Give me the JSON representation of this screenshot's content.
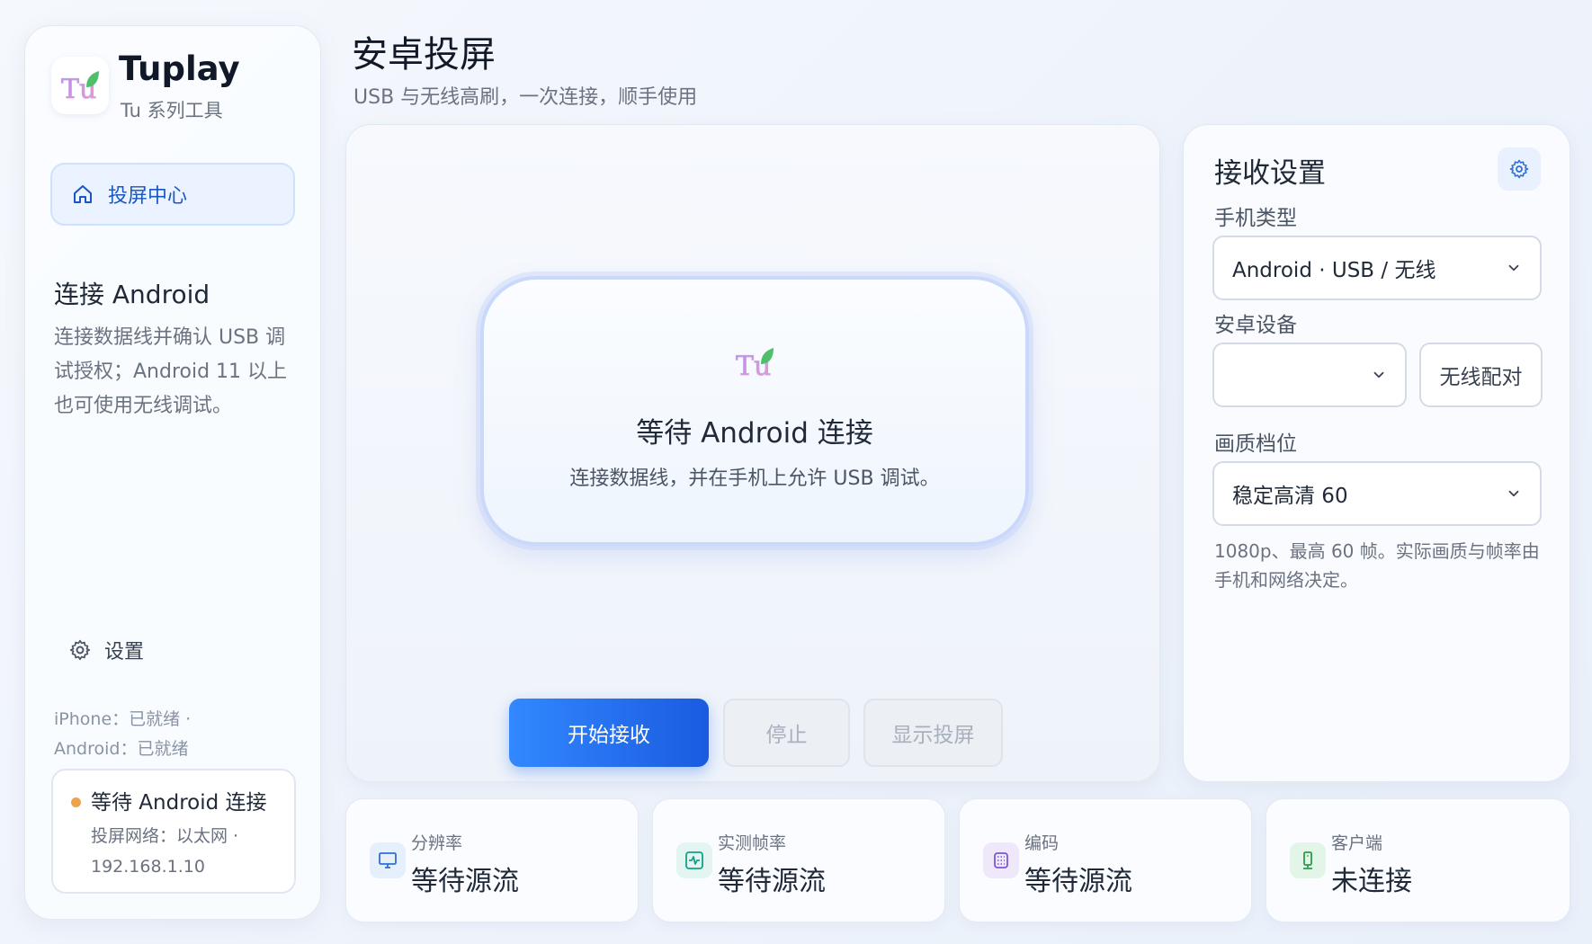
{
  "sidebar": {
    "brand_name": "Tuplay",
    "brand_sub": "Tu 系列工具",
    "nav_active_label": "投屏中心",
    "section_title": "连接 Android",
    "section_desc": "连接数据线并确认 USB 调试授权；Android 11 以上也可使用无线调试。",
    "settings_label": "设置",
    "ready_iphone": "iPhone：已就绪 ·",
    "ready_android": "Android：已就绪",
    "status": {
      "title": "等待 Android 连接",
      "network": "投屏网络：以太网 ·",
      "ip": "192.168.1.10",
      "dot_color": "#f0a24a"
    }
  },
  "header": {
    "title": "安卓投屏",
    "subtitle": "USB 与无线高刷，一次连接，顺手使用"
  },
  "main": {
    "wait_title": "等待 Android 连接",
    "wait_desc": "连接数据线，并在手机上允许 USB 调试。",
    "start_button": "开始接收",
    "stop_button": "停止",
    "show_button": "显示投屏"
  },
  "settings": {
    "title": "接收设置",
    "phone_type_label": "手机类型",
    "phone_type_value": "Android · USB / 无线",
    "device_label": "安卓设备",
    "device_value": "",
    "wireless_pair_button": "无线配对",
    "quality_label": "画质档位",
    "quality_value": "稳定高清 60",
    "quality_note": "1080p、最高 60 帧。实际画质与帧率由手机和网络决定。"
  },
  "stats": [
    {
      "label": "分辨率",
      "value": "等待源流",
      "icon": "monitor-icon",
      "color": "#2f6fd6"
    },
    {
      "label": "实测帧率",
      "value": "等待源流",
      "icon": "activity-icon",
      "color": "#14a08a"
    },
    {
      "label": "编码",
      "value": "等待源流",
      "icon": "chip-icon",
      "color": "#7a55d8"
    },
    {
      "label": "客户端",
      "value": "未连接",
      "icon": "phone-device-icon",
      "color": "#2c9a4c"
    }
  ],
  "colors": {
    "accent": "#1a5be0",
    "accent_light": "#3288ff",
    "nav_active_text": "#1a56c4"
  }
}
